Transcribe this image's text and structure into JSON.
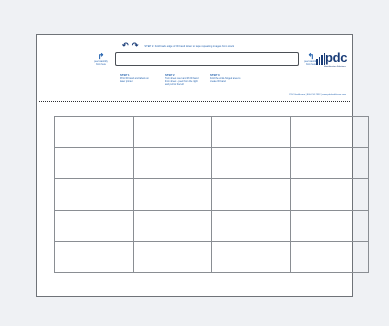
{
  "header": {
    "top_instruction": "STEP 2: Fold back edge of ID band down to tape repeating images from stock",
    "left_peel_label": "peel carefully\nfrom here",
    "right_peel_label": "peel carefully\nfrom here"
  },
  "logo": {
    "text": "pdc",
    "tagline": "Identification Solutions"
  },
  "steps": [
    {
      "title": "STEP 1",
      "desc": "Print ID band and labels on laser printer"
    },
    {
      "title": "STEP 2",
      "desc": "Turn sheet over and lift ID band from sheet - peel from the right and pull to the left"
    },
    {
      "title": "STEP 3",
      "desc": "Fold the wrist-hinged area to create ID band"
    }
  ],
  "footnote": "PDC Healthcare | 800-214-7332 | www.pdchealthcare.com",
  "grid": {
    "rows": 5,
    "columns": 4
  },
  "colors": {
    "instruction_blue": "#1f5fad",
    "logo_navy": "#1a3d78",
    "page_background": "#eff1f4",
    "sheet_border": "#6f7378"
  }
}
